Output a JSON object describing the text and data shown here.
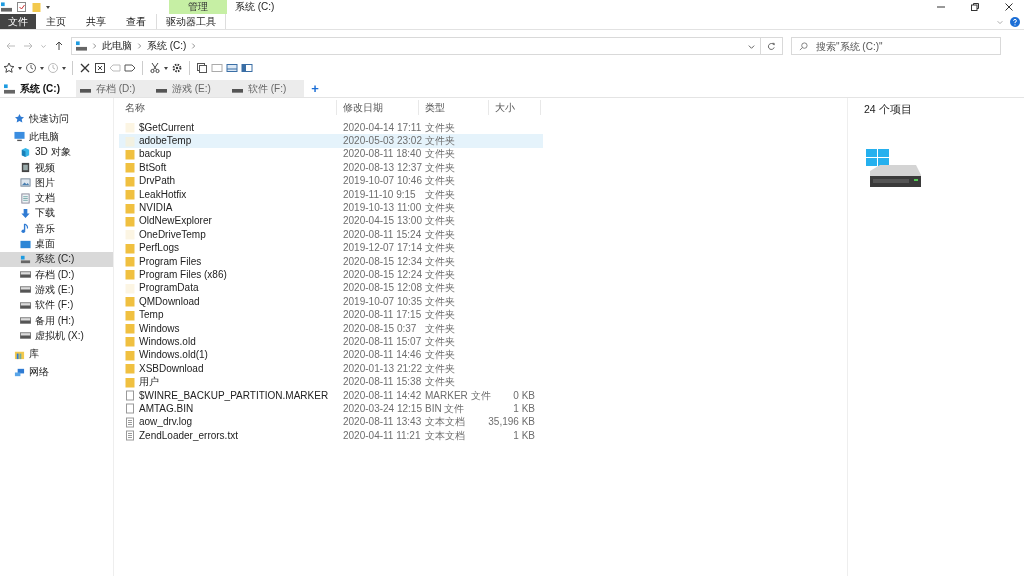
{
  "window": {
    "title": "系统 (C:)",
    "context_group": "管理"
  },
  "ribbon_tabs": [
    {
      "label": "文件",
      "kind": "file"
    },
    {
      "label": "主页",
      "kind": "plain"
    },
    {
      "label": "共享",
      "kind": "plain"
    },
    {
      "label": "查看",
      "kind": "plain"
    },
    {
      "label": "驱动器工具",
      "kind": "context"
    }
  ],
  "address_bar": {
    "crumbs": [
      "此电脑",
      "系统 (C:)"
    ]
  },
  "search": {
    "placeholder": "搜索\"系统 (C:)\""
  },
  "tabs": [
    {
      "label": "系统 (C:)",
      "selected": true,
      "kind": "windrive"
    },
    {
      "label": "存档 (D:)",
      "selected": false,
      "kind": "drive"
    },
    {
      "label": "游戏 (E:)",
      "selected": false,
      "kind": "drive"
    },
    {
      "label": "软件 (F:)",
      "selected": false,
      "kind": "drive"
    }
  ],
  "new_tab": "+",
  "sidebar": {
    "items": [
      {
        "label": "快速访问",
        "kind": "star",
        "selected": false
      },
      {
        "label": "此电脑",
        "kind": "pc",
        "selected": false,
        "children": [
          {
            "label": "3D 对象",
            "kind": "cube",
            "selected": false
          },
          {
            "label": "视频",
            "kind": "video",
            "selected": false
          },
          {
            "label": "图片",
            "kind": "picture",
            "selected": false
          },
          {
            "label": "文档",
            "kind": "doc",
            "selected": false
          },
          {
            "label": "下载",
            "kind": "download",
            "selected": false
          },
          {
            "label": "音乐",
            "kind": "music",
            "selected": false
          },
          {
            "label": "桌面",
            "kind": "desktop",
            "selected": false
          },
          {
            "label": "系统 (C:)",
            "kind": "windrive",
            "selected": true
          },
          {
            "label": "存档 (D:)",
            "kind": "drive",
            "selected": false
          },
          {
            "label": "游戏 (E:)",
            "kind": "drive",
            "selected": false
          },
          {
            "label": "软件 (F:)",
            "kind": "drive",
            "selected": false
          },
          {
            "label": "备用 (H:)",
            "kind": "drive",
            "selected": false
          },
          {
            "label": "虚拟机 (X:)",
            "kind": "drive",
            "selected": false
          }
        ]
      },
      {
        "label": "库",
        "kind": "library",
        "selected": false
      },
      {
        "label": "网络",
        "kind": "network",
        "selected": false
      }
    ]
  },
  "table": {
    "columns": [
      "名称",
      "修改日期",
      "类型",
      "大小"
    ],
    "rows": [
      {
        "name": "$GetCurrent",
        "date": "2020-04-14 17:11",
        "type": "文件夹",
        "kind": "folder",
        "hidden": true,
        "selected": false
      },
      {
        "name": "adobeTemp",
        "date": "2020-05-03 23:02",
        "type": "文件夹",
        "kind": "folder",
        "hidden": true,
        "selected": true
      },
      {
        "name": "backup",
        "date": "2020-08-11 18:40",
        "type": "文件夹",
        "kind": "folder",
        "hidden": false,
        "selected": false
      },
      {
        "name": "BtSoft",
        "date": "2020-08-13 12:37",
        "type": "文件夹",
        "kind": "folder",
        "hidden": false,
        "selected": false
      },
      {
        "name": "DrvPath",
        "date": "2019-10-07 10:46",
        "type": "文件夹",
        "kind": "folder",
        "hidden": false,
        "selected": false
      },
      {
        "name": "LeakHotfix",
        "date": "2019-11-10 9:15",
        "type": "文件夹",
        "kind": "folder",
        "hidden": false,
        "selected": false
      },
      {
        "name": "NVIDIA",
        "date": "2019-10-13 11:00",
        "type": "文件夹",
        "kind": "folder",
        "hidden": false,
        "selected": false
      },
      {
        "name": "OldNewExplorer",
        "date": "2020-04-15 13:00",
        "type": "文件夹",
        "kind": "folder",
        "hidden": false,
        "selected": false
      },
      {
        "name": "OneDriveTemp",
        "date": "2020-08-11 15:24",
        "type": "文件夹",
        "kind": "folder",
        "hidden": true,
        "selected": false
      },
      {
        "name": "PerfLogs",
        "date": "2019-12-07 17:14",
        "type": "文件夹",
        "kind": "folder",
        "hidden": false,
        "selected": false
      },
      {
        "name": "Program Files",
        "date": "2020-08-15 12:34",
        "type": "文件夹",
        "kind": "folder",
        "hidden": false,
        "selected": false
      },
      {
        "name": "Program Files (x86)",
        "date": "2020-08-15 12:24",
        "type": "文件夹",
        "kind": "folder",
        "hidden": false,
        "selected": false
      },
      {
        "name": "ProgramData",
        "date": "2020-08-15 12:08",
        "type": "文件夹",
        "kind": "folder",
        "hidden": true,
        "selected": false
      },
      {
        "name": "QMDownload",
        "date": "2019-10-07 10:35",
        "type": "文件夹",
        "kind": "folder",
        "hidden": false,
        "selected": false
      },
      {
        "name": "Temp",
        "date": "2020-08-11 17:15",
        "type": "文件夹",
        "kind": "folder",
        "hidden": false,
        "selected": false
      },
      {
        "name": "Windows",
        "date": "2020-08-15 0:37",
        "type": "文件夹",
        "kind": "folder",
        "hidden": false,
        "selected": false
      },
      {
        "name": "Windows.old",
        "date": "2020-08-11 15:07",
        "type": "文件夹",
        "kind": "folder",
        "hidden": false,
        "selected": false
      },
      {
        "name": "Windows.old(1)",
        "date": "2020-08-11 14:46",
        "type": "文件夹",
        "kind": "folder",
        "hidden": false,
        "selected": false
      },
      {
        "name": "XSBDownload",
        "date": "2020-01-13 21:22",
        "type": "文件夹",
        "kind": "folder",
        "hidden": false,
        "selected": false
      },
      {
        "name": "用户",
        "date": "2020-08-11 15:38",
        "type": "文件夹",
        "kind": "folder",
        "hidden": false,
        "selected": false
      },
      {
        "name": "$WINRE_BACKUP_PARTITION.MARKER",
        "date": "2020-08-11 14:42",
        "type": "MARKER 文件",
        "size": "0 KB",
        "kind": "file",
        "selected": false
      },
      {
        "name": "AMTAG.BIN",
        "date": "2020-03-24 12:15",
        "type": "BIN 文件",
        "size": "1 KB",
        "kind": "file",
        "selected": false
      },
      {
        "name": "aow_drv.log",
        "date": "2020-08-11 13:43",
        "type": "文本文档",
        "size": "35,196 KB",
        "kind": "text",
        "selected": false
      },
      {
        "name": "ZendLoader_errors.txt",
        "date": "2020-04-11 11:21",
        "type": "文本文档",
        "size": "1 KB",
        "kind": "text",
        "selected": false
      }
    ]
  },
  "details_pane": {
    "item_count": "24 个项目"
  }
}
